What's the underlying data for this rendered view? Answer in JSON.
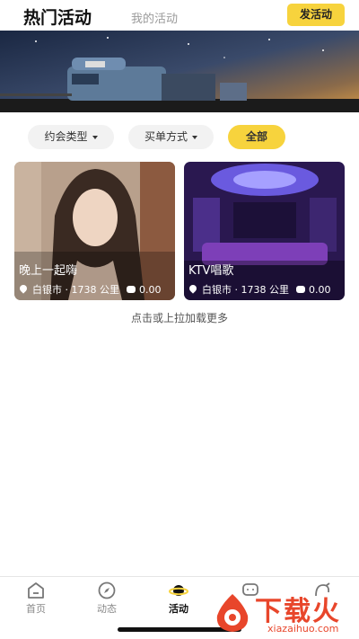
{
  "header": {
    "active_tab": "热门活动",
    "inactive_tab": "我的活动",
    "publish_label": "发活动"
  },
  "filters": {
    "date_type": "约会类型",
    "pay_method": "买单方式",
    "all": "全部"
  },
  "cards": [
    {
      "title": "晚上一起嗨",
      "location": "白银市 · 1738 公里",
      "price": "0.00"
    },
    {
      "title": "KTV唱歌",
      "location": "白银市 · 1738 公里",
      "price": "0.00"
    }
  ],
  "load_more": "点击或上拉加载更多",
  "nav": {
    "home": "首页",
    "moments": "动态",
    "activity": "活动"
  },
  "watermark": {
    "text": "下载火",
    "url": "xiazaihuo.com"
  },
  "colors": {
    "accent": "#f7d33d",
    "watermark": "#e8462b"
  }
}
